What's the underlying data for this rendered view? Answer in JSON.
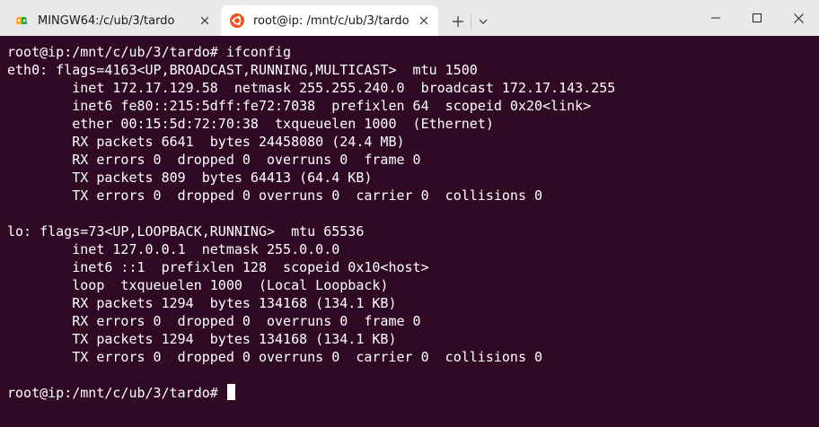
{
  "tabs": [
    {
      "title": "MINGW64:/c/ub/3/tardo",
      "icon": "git-bash-icon"
    },
    {
      "title": "root@ip: /mnt/c/ub/3/tardo",
      "icon": "ubuntu-icon"
    }
  ],
  "window_controls": {
    "minimize": "minimize-icon",
    "maximize": "maximize-icon",
    "close": "close-icon"
  },
  "colors": {
    "terminal_bg": "#300a24",
    "terminal_fg": "#ffffff",
    "titlebar_bg": "#e9e9e9",
    "ubuntu_orange": "#e95420"
  },
  "terminal": {
    "lines": [
      "root@ip:/mnt/c/ub/3/tardo# ifconfig",
      "eth0: flags=4163<UP,BROADCAST,RUNNING,MULTICAST>  mtu 1500",
      "        inet 172.17.129.58  netmask 255.255.240.0  broadcast 172.17.143.255",
      "        inet6 fe80::215:5dff:fe72:7038  prefixlen 64  scopeid 0x20<link>",
      "        ether 00:15:5d:72:70:38  txqueuelen 1000  (Ethernet)",
      "        RX packets 6641  bytes 24458080 (24.4 MB)",
      "        RX errors 0  dropped 0  overruns 0  frame 0",
      "        TX packets 809  bytes 64413 (64.4 KB)",
      "        TX errors 0  dropped 0 overruns 0  carrier 0  collisions 0",
      "",
      "lo: flags=73<UP,LOOPBACK,RUNNING>  mtu 65536",
      "        inet 127.0.0.1  netmask 255.0.0.0",
      "        inet6 ::1  prefixlen 128  scopeid 0x10<host>",
      "        loop  txqueuelen 1000  (Local Loopback)",
      "        RX packets 1294  bytes 134168 (134.1 KB)",
      "        RX errors 0  dropped 0  overruns 0  frame 0",
      "        TX packets 1294  bytes 134168 (134.1 KB)",
      "        TX errors 0  dropped 0 overruns 0  carrier 0  collisions 0",
      "",
      "root@ip:/mnt/c/ub/3/tardo# "
    ]
  }
}
